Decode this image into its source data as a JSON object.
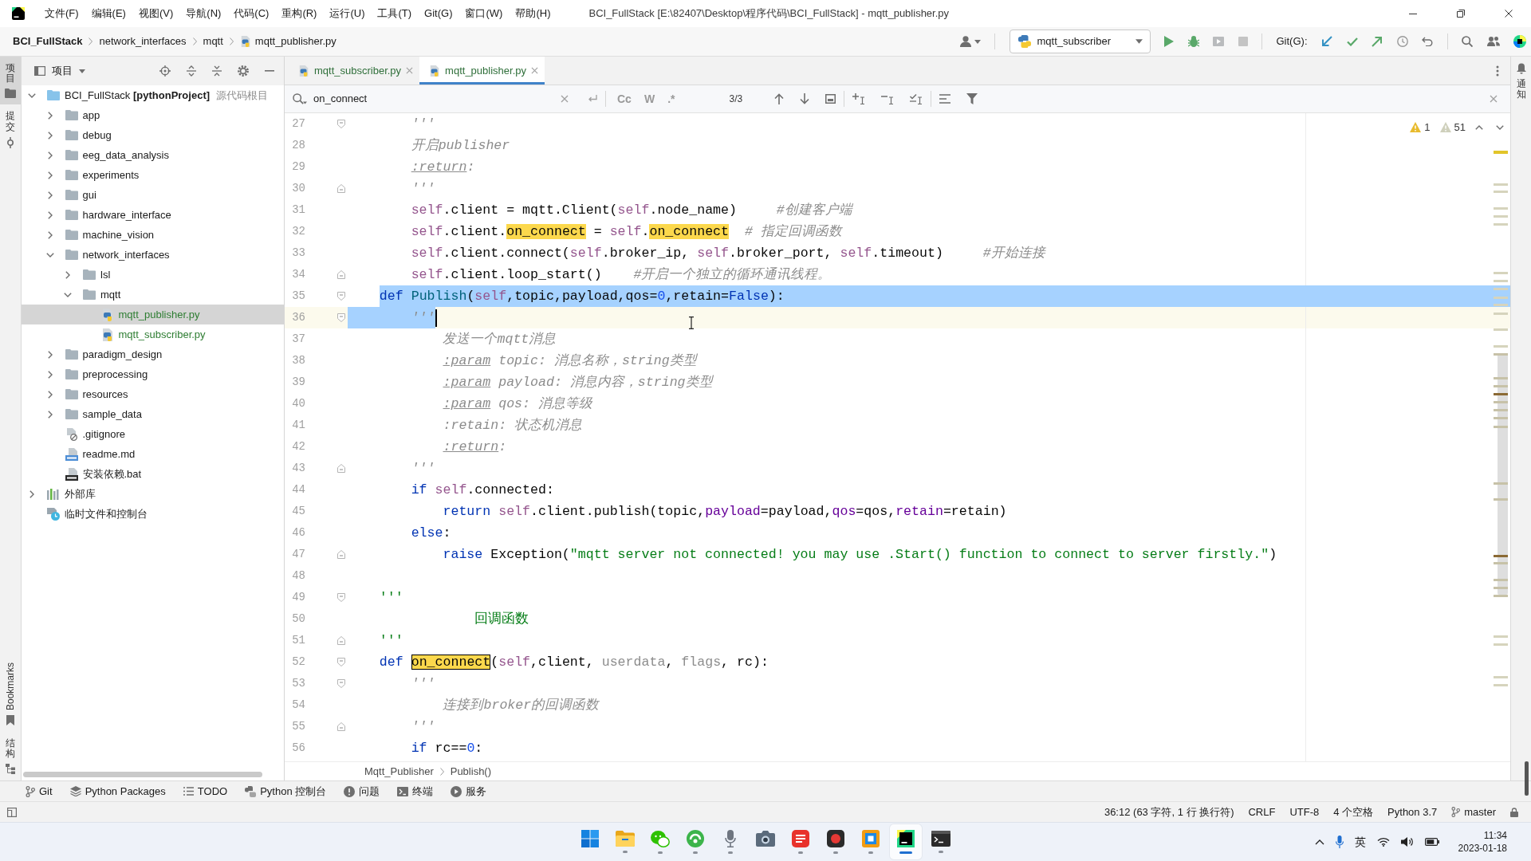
{
  "title_bar": {
    "menus": [
      "文件(F)",
      "编辑(E)",
      "视图(V)",
      "导航(N)",
      "代码(C)",
      "重构(R)",
      "运行(U)",
      "工具(T)",
      "Git(G)",
      "窗口(W)",
      "帮助(H)"
    ],
    "title": "BCI_FullStack [E:\\82407\\Desktop\\程序代码\\BCI_FullStack] - mqtt_publisher.py"
  },
  "nav_bar": {
    "breadcrumbs": [
      {
        "label": "BCI_FullStack",
        "kind": "project"
      },
      {
        "label": "network_interfaces",
        "kind": "folder"
      },
      {
        "label": "mqtt",
        "kind": "folder"
      },
      {
        "label": "mqtt_publisher.py",
        "kind": "python"
      }
    ],
    "run_config": "mqtt_subscriber",
    "git_label": "Git(G):"
  },
  "left_strip": {
    "top": [
      {
        "label": "项目",
        "kind": "project",
        "selected": true
      },
      {
        "label": "提交",
        "kind": "commit",
        "selected": false
      }
    ],
    "bottom": [
      {
        "label": "Bookmarks",
        "kind": "bookmarks",
        "selected": false
      },
      {
        "label": "结构",
        "kind": "structure",
        "selected": false
      }
    ]
  },
  "right_strip": {
    "items": [
      {
        "label": "通知",
        "kind": "notifications",
        "selected": false
      }
    ]
  },
  "project_panel": {
    "title": "项目",
    "tree": [
      {
        "label": "BCI_FullStack **[pythonProject]**",
        "note": "源代码根目",
        "kind": "project",
        "expanded": true,
        "selected": false,
        "children": [
          {
            "label": "app",
            "kind": "folder",
            "expanded": false,
            "selected": false
          },
          {
            "label": "debug",
            "kind": "folder",
            "expanded": false,
            "selected": false
          },
          {
            "label": "eeg_data_analysis",
            "kind": "folder",
            "expanded": false,
            "selected": false
          },
          {
            "label": "experiments",
            "kind": "folder",
            "expanded": false,
            "selected": false
          },
          {
            "label": "gui",
            "kind": "folder",
            "expanded": false,
            "selected": false
          },
          {
            "label": "hardware_interface",
            "kind": "folder",
            "expanded": false,
            "selected": false
          },
          {
            "label": "machine_vision",
            "kind": "folder",
            "expanded": false,
            "selected": false
          },
          {
            "label": "network_interfaces",
            "kind": "folder",
            "expanded": true,
            "selected": false,
            "children": [
              {
                "label": "lsl",
                "kind": "folder",
                "expanded": false,
                "selected": false
              },
              {
                "label": "mqtt",
                "kind": "folder",
                "expanded": true,
                "selected": false,
                "children": [
                  {
                    "label": "mqtt_publisher.py",
                    "kind": "python",
                    "added": true,
                    "selected": true
                  },
                  {
                    "label": "mqtt_subscriber.py",
                    "kind": "python",
                    "added": true,
                    "selected": false
                  }
                ]
              }
            ]
          },
          {
            "label": "paradigm_design",
            "kind": "folder",
            "expanded": false,
            "selected": false
          },
          {
            "label": "preprocessing",
            "kind": "folder",
            "expanded": false,
            "selected": false
          },
          {
            "label": "resources",
            "kind": "folder",
            "expanded": false,
            "selected": false
          },
          {
            "label": "sample_data",
            "kind": "folder",
            "expanded": false,
            "selected": false
          },
          {
            "label": ".gitignore",
            "kind": "gitignore",
            "added": false,
            "selected": false
          },
          {
            "label": "readme.md",
            "kind": "markdown",
            "added": false,
            "selected": false
          },
          {
            "label": "安装依赖.bat",
            "kind": "bat",
            "added": false,
            "selected": false
          }
        ]
      },
      {
        "label": "外部库",
        "kind": "library",
        "expanded": false,
        "selected": false
      },
      {
        "label": "临时文件和控制台",
        "kind": "scratches",
        "selected": false
      }
    ]
  },
  "editor": {
    "tabs": [
      {
        "label": "mqtt_subscriber.py",
        "added": true,
        "selected": false
      },
      {
        "label": "mqtt_publisher.py",
        "added": true,
        "selected": true
      }
    ],
    "search": {
      "value": "on_connect",
      "options": [
        {
          "label": "Cc",
          "selected": false
        },
        {
          "label": "W",
          "selected": false
        },
        {
          "label": ".*",
          "selected": false
        }
      ],
      "count": "3/3"
    },
    "inspections": [
      {
        "kind": "warning",
        "count": "1"
      },
      {
        "kind": "weak-warning",
        "count": "51"
      }
    ],
    "lines": [
      {
        "number": "27",
        "fold_start": true,
        "tokens": [
          {
            "text": "        '''",
            "kind": "docstring"
          }
        ]
      },
      {
        "number": "28",
        "tokens": [
          {
            "text": "        开启publisher",
            "kind": "docstring"
          }
        ]
      },
      {
        "number": "29",
        "tokens": [
          {
            "text": "        :return",
            "kind": "doctag"
          },
          {
            "text": ":",
            "kind": "docstring"
          }
        ]
      },
      {
        "number": "30",
        "fold_end": true,
        "tokens": [
          {
            "text": "        '''",
            "kind": "docstring"
          }
        ]
      },
      {
        "number": "31",
        "tokens": [
          {
            "text": "        self",
            "kind": "self"
          },
          {
            "text": ".client = mqtt.Client(",
            "kind": "plain"
          },
          {
            "text": "self",
            "kind": "self"
          },
          {
            "text": ".node_name)     ",
            "kind": "plain"
          },
          {
            "text": "#创建客户端",
            "kind": "comment"
          }
        ]
      },
      {
        "number": "32",
        "tokens": [
          {
            "text": "        self",
            "kind": "self"
          },
          {
            "text": ".client.",
            "kind": "plain"
          },
          {
            "text": "on_connect",
            "kind": "match"
          },
          {
            "text": " = ",
            "kind": "plain"
          },
          {
            "text": "self",
            "kind": "self"
          },
          {
            "text": ".",
            "kind": "plain"
          },
          {
            "text": "on_connect",
            "kind": "match"
          },
          {
            "text": "  # 指定回调函数",
            "kind": "comment"
          }
        ]
      },
      {
        "number": "33",
        "tokens": [
          {
            "text": "        self",
            "kind": "self"
          },
          {
            "text": ".client.connect(",
            "kind": "plain"
          },
          {
            "text": "self",
            "kind": "self"
          },
          {
            "text": ".broker_ip, ",
            "kind": "plain"
          },
          {
            "text": "self",
            "kind": "self"
          },
          {
            "text": ".broker_port, ",
            "kind": "plain"
          },
          {
            "text": "self",
            "kind": "self"
          },
          {
            "text": ".timeout)     ",
            "kind": "plain"
          },
          {
            "text": "#开始连接",
            "kind": "comment"
          }
        ]
      },
      {
        "number": "34",
        "fold_end": true,
        "tokens": [
          {
            "text": "        self",
            "kind": "self"
          },
          {
            "text": ".client.loop_start()    ",
            "kind": "plain"
          },
          {
            "text": "#开启一个独立的循环通讯线程。",
            "kind": "comment"
          }
        ]
      },
      {
        "number": "35",
        "fold_start": true,
        "selected": true,
        "tokens": [
          {
            "text": "    def ",
            "kind": "keyword"
          },
          {
            "text": "Publish",
            "kind": "func"
          },
          {
            "text": "(",
            "kind": "plain"
          },
          {
            "text": "self",
            "kind": "self"
          },
          {
            "text": ",topic,payload,qos=",
            "kind": "plain"
          },
          {
            "text": "0",
            "kind": "number"
          },
          {
            "text": ",retain=",
            "kind": "plain"
          },
          {
            "text": "False",
            "kind": "keyword"
          },
          {
            "text": "):",
            "kind": "plain"
          }
        ]
      },
      {
        "number": "36",
        "fold_start": true,
        "selected": true,
        "current": true,
        "tokens": [
          {
            "text": "        '''",
            "kind": "docstring"
          }
        ]
      },
      {
        "number": "37",
        "tokens": [
          {
            "text": "            发送一个mqtt消息",
            "kind": "docstring"
          }
        ]
      },
      {
        "number": "38",
        "tokens": [
          {
            "text": "            :param",
            "kind": "doctag"
          },
          {
            "text": " topic: 消息名称，string类型",
            "kind": "docstring"
          }
        ]
      },
      {
        "number": "39",
        "tokens": [
          {
            "text": "            :param",
            "kind": "doctag"
          },
          {
            "text": " payload: 消息内容，string类型",
            "kind": "docstring"
          }
        ]
      },
      {
        "number": "40",
        "tokens": [
          {
            "text": "            :param",
            "kind": "doctag"
          },
          {
            "text": " qos: 消息等级",
            "kind": "docstring"
          }
        ]
      },
      {
        "number": "41",
        "tokens": [
          {
            "text": "            :retain: 状态机消息",
            "kind": "docstring"
          }
        ]
      },
      {
        "number": "42",
        "tokens": [
          {
            "text": "            :return",
            "kind": "doctag"
          },
          {
            "text": ":",
            "kind": "docstring"
          }
        ]
      },
      {
        "number": "43",
        "fold_end": true,
        "tokens": [
          {
            "text": "        '''",
            "kind": "docstring"
          }
        ]
      },
      {
        "number": "44",
        "tokens": [
          {
            "text": "        if ",
            "kind": "keyword"
          },
          {
            "text": "self",
            "kind": "self"
          },
          {
            "text": ".connected:",
            "kind": "plain"
          }
        ]
      },
      {
        "number": "45",
        "tokens": [
          {
            "text": "            return ",
            "kind": "keyword"
          },
          {
            "text": "self",
            "kind": "self"
          },
          {
            "text": ".client.publish(topic,",
            "kind": "plain"
          },
          {
            "text": "payload",
            "kind": "kwarg"
          },
          {
            "text": "=payload,",
            "kind": "plain"
          },
          {
            "text": "qos",
            "kind": "kwarg"
          },
          {
            "text": "=qos,",
            "kind": "plain"
          },
          {
            "text": "retain",
            "kind": "kwarg"
          },
          {
            "text": "=retain)",
            "kind": "plain"
          }
        ]
      },
      {
        "number": "46",
        "tokens": [
          {
            "text": "        else",
            "kind": "keyword"
          },
          {
            "text": ":",
            "kind": "plain"
          }
        ]
      },
      {
        "number": "47",
        "fold_end": true,
        "tokens": [
          {
            "text": "            raise ",
            "kind": "keyword"
          },
          {
            "text": "Exception(",
            "kind": "plain"
          },
          {
            "text": "\"mqtt server not connected! you may use .Start() function to connect to server firstly.\"",
            "kind": "string"
          },
          {
            "text": ")",
            "kind": "plain"
          }
        ]
      },
      {
        "number": "48"
      },
      {
        "number": "49",
        "fold_start": true,
        "tokens": [
          {
            "text": "    '''",
            "kind": "string"
          }
        ]
      },
      {
        "number": "50",
        "tokens": [
          {
            "text": "                回调函数",
            "kind": "string"
          }
        ]
      },
      {
        "number": "51",
        "fold_end": true,
        "tokens": [
          {
            "text": "    '''",
            "kind": "string"
          }
        ]
      },
      {
        "number": "52",
        "fold_start": true,
        "tokens": [
          {
            "text": "    def ",
            "kind": "keyword"
          },
          {
            "text": "on_connect",
            "kind": "current-match"
          },
          {
            "text": "(",
            "kind": "plain"
          },
          {
            "text": "self",
            "kind": "self"
          },
          {
            "text": ",client, ",
            "kind": "plain"
          },
          {
            "text": "userdata",
            "kind": "unused"
          },
          {
            "text": ", ",
            "kind": "plain"
          },
          {
            "text": "flags",
            "kind": "unused"
          },
          {
            "text": ", rc):",
            "kind": "plain"
          }
        ]
      },
      {
        "number": "53",
        "fold_start": true,
        "tokens": [
          {
            "text": "        '''",
            "kind": "docstring"
          }
        ]
      },
      {
        "number": "54",
        "tokens": [
          {
            "text": "            连接到broker的回调函数",
            "kind": "docstring"
          }
        ]
      },
      {
        "number": "55",
        "fold_end": true,
        "tokens": [
          {
            "text": "        '''",
            "kind": "docstring"
          }
        ]
      },
      {
        "number": "56",
        "tokens": [
          {
            "text": "        if ",
            "kind": "keyword"
          },
          {
            "text": "rc==",
            "kind": "plain"
          },
          {
            "text": "0",
            "kind": "number"
          },
          {
            "text": ":",
            "kind": "plain"
          }
        ]
      }
    ],
    "breadcrumbs": [
      "Mqtt_Publisher",
      "Publish()"
    ]
  },
  "tool_tabs": [
    {
      "label": "Git",
      "kind": "git"
    },
    {
      "label": "Python Packages",
      "kind": "packages"
    },
    {
      "label": "TODO",
      "kind": "todo"
    },
    {
      "label": "Python 控制台",
      "kind": "python-console"
    },
    {
      "label": "问题",
      "kind": "problems"
    },
    {
      "label": "终端",
      "kind": "terminal"
    },
    {
      "label": "服务",
      "kind": "services"
    }
  ],
  "status_bar": {
    "position": "36:12 (63 字符, 1 行 换行符)",
    "line_separator": "CRLF",
    "encoding": "UTF-8",
    "indentation": "4 个空格",
    "interpreter": "Python 3.7",
    "branch": "master"
  },
  "taskbar": {
    "apps": [
      {
        "kind": "start",
        "running": false,
        "selected": false
      },
      {
        "kind": "explorer",
        "running": true,
        "selected": false
      },
      {
        "kind": "chat",
        "running": true,
        "selected": false
      },
      {
        "kind": "circle-app",
        "running": true,
        "selected": false
      },
      {
        "kind": "microphone",
        "running": true,
        "selected": false
      },
      {
        "kind": "camera",
        "running": false,
        "selected": false
      },
      {
        "kind": "document-app",
        "running": true,
        "selected": false
      },
      {
        "kind": "record",
        "running": true,
        "selected": false
      },
      {
        "kind": "square-app",
        "running": true,
        "selected": false
      },
      {
        "kind": "ide",
        "running": true,
        "selected": true
      },
      {
        "kind": "terminal",
        "running": true,
        "selected": false
      }
    ],
    "ime": "英",
    "time": "11:34",
    "date": "2023-01-18"
  }
}
